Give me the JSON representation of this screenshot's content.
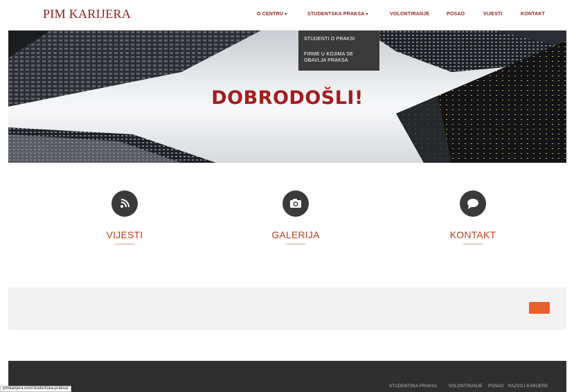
{
  "navbar": {
    "brand": "PIM KARIJERA",
    "items": [
      {
        "label": "O CENTRU",
        "has_caret": true
      },
      {
        "label": "STUDENTSKA PRAKSA",
        "has_caret": true
      },
      {
        "label": "VOLONTIRANJE",
        "has_caret": false
      },
      {
        "label": "POSAO",
        "has_caret": false
      },
      {
        "label": "VIJESTI",
        "has_caret": false
      },
      {
        "label": "KONTAKT",
        "has_caret": false
      }
    ],
    "caret": "▾"
  },
  "dropdown": {
    "items": [
      "STUDENTI O PRAKSI",
      "FIRME U KOJIMA SE OBAVLJA PRAKSA"
    ]
  },
  "hero": {
    "title": "DOBRODOŠLI!"
  },
  "features": [
    {
      "label": "VIJESTI",
      "icon": "rss-icon"
    },
    {
      "label": "GALERIJA",
      "icon": "camera-icon"
    },
    {
      "label": "KONTAKT",
      "icon": "chat-bubble-icon"
    }
  ],
  "band": {
    "button_color": "#e8602c"
  },
  "footer": {
    "links": [
      "STUDENTSKA PRAKSA",
      "VOLONTIRANJE",
      "POSAO",
      "RAZVOJ KARIJERE"
    ]
  },
  "statusbar": {
    "url": "pimkarijera.com/studentska-praksa/"
  },
  "colors": {
    "brand": "#8c1d1d",
    "hero_title": "#a51d1d",
    "feature_label": "#b8401f",
    "footer_bg": "#2f2f2f"
  }
}
